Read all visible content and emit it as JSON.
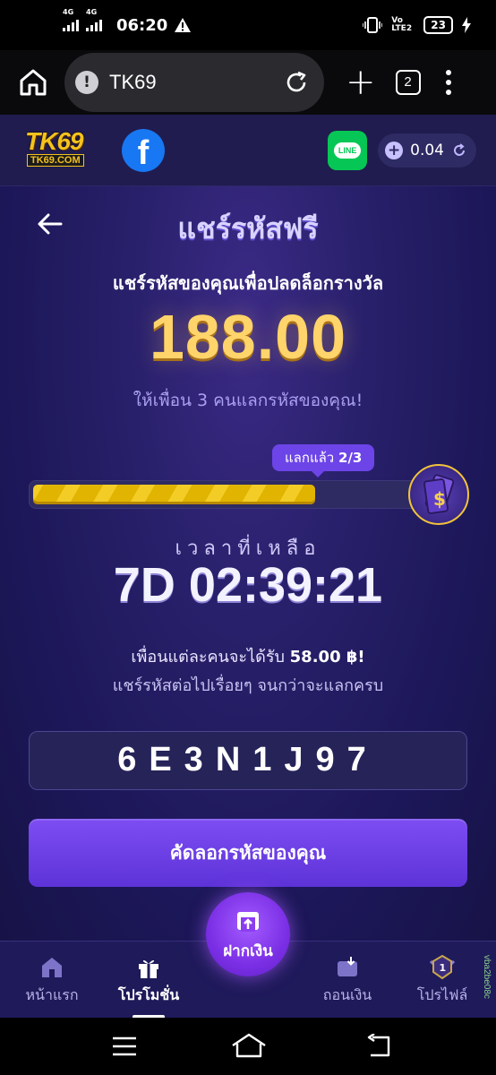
{
  "status_bar": {
    "network_1": "4G",
    "network_2": "4G",
    "time": "06:20",
    "volte": "Vo LTE2",
    "battery": "23"
  },
  "browser": {
    "url": "TK69",
    "tab_count": "2"
  },
  "site_header": {
    "logo_main": "TK69",
    "logo_sub": "TK69.COM",
    "facebook_glyph": "f",
    "line_label": "LINE",
    "balance": "0.04"
  },
  "page": {
    "title": "แชร์รหัสฟรี",
    "subtitle": "แชร์รหัสของคุณเพื่อปลดล็อกรางวัล",
    "amount": "188.00",
    "invite_text": "ให้เพื่อน 3 คนแลกรหัสของคุณ!",
    "progress_badge_label": "แลกแล้ว",
    "progress_badge_value": "2/3",
    "progress_fraction": 0.7333,
    "remaining_label": "เวลาที่เหลือ",
    "countdown": "7D 02:39:21",
    "desc_line1_prefix": "เพื่อนแต่ละคนจะได้รับ",
    "desc_line1_amount": "58.00 ฿!",
    "desc_line2": "แชร์รหัสต่อไปเรื่อยๆ จนกว่าจะแลกครบ",
    "share_code": "6E3N1J97",
    "copy_button": "คัดลอกรหัสของคุณ"
  },
  "bottom_nav": {
    "items": [
      {
        "label": "หน้าแรก",
        "icon": "home-icon"
      },
      {
        "label": "โปรโมชั่น",
        "icon": "gift-icon"
      },
      {
        "label": "ฝากเงิน",
        "icon": "deposit-icon"
      },
      {
        "label": "ถอนเงิน",
        "icon": "wallet-icon"
      },
      {
        "label": "โปรไฟล์",
        "icon": "rank-badge-icon"
      }
    ],
    "profile_rank": "1",
    "active_index": 1
  },
  "watermark": "vba2be08c",
  "colors": {
    "header_bg": "#201c4f",
    "accent_purple": "#6d44e8",
    "gold": "#ffd46a",
    "progress_fill": "#e0b400"
  }
}
